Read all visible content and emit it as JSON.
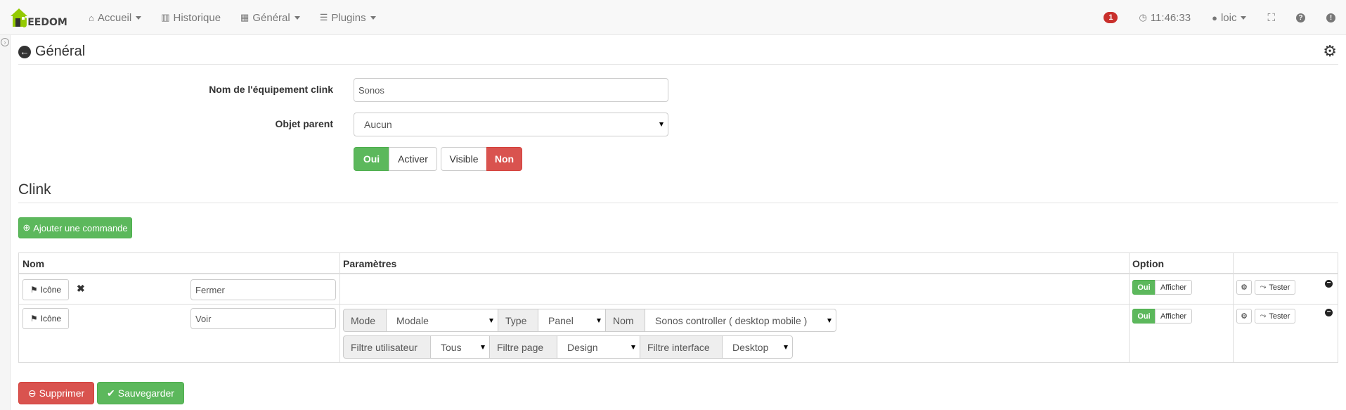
{
  "navbar": {
    "brand_first": "J",
    "brand_rest": "EEDOM",
    "items": [
      {
        "label": "Accueil",
        "icon": "home-icon"
      },
      {
        "label": "Historique",
        "icon": "bar-chart-icon"
      },
      {
        "label": "Général",
        "icon": "qrcode-icon"
      },
      {
        "label": "Plugins",
        "icon": "tasks-icon"
      }
    ],
    "notification_count": "1",
    "clock": "11:46:33",
    "user": "loic"
  },
  "page": {
    "title": "Général",
    "equipment_name_label": "Nom de l'équipement clink",
    "equipment_name_value": "Sonos",
    "parent_label": "Objet parent",
    "parent_value": "Aucun",
    "toggle_active_on": "Oui",
    "toggle_active_label": "Activer",
    "toggle_visible_label": "Visible",
    "toggle_visible_off": "Non"
  },
  "section": {
    "title": "Clink",
    "add_command": "Ajouter une commande"
  },
  "table": {
    "headers": [
      "Nom",
      "Paramètres",
      "Option",
      ""
    ],
    "rows": [
      {
        "icon_btn": "Icône",
        "name": "Fermer",
        "option_on": "Oui",
        "option_label": "Afficher",
        "test_label": "Tester"
      },
      {
        "icon_btn": "Icône",
        "name": "Voir",
        "mode_label": "Mode",
        "mode_value": "Modale",
        "type_label": "Type",
        "type_value": "Panel",
        "nom_label": "Nom",
        "nom_value": "Sonos controller ( desktop mobile )",
        "user_filter_label": "Filtre utilisateur",
        "user_filter_value": "Tous",
        "page_filter_label": "Filtre page",
        "page_filter_value": "Design",
        "interface_filter_label": "Filtre interface",
        "interface_filter_value": "Desktop",
        "option_on": "Oui",
        "option_label": "Afficher",
        "test_label": "Tester"
      }
    ]
  },
  "actions": {
    "delete": "Supprimer",
    "save": "Sauvegarder"
  },
  "colors": {
    "success": "#5cb85c",
    "danger": "#d9534f",
    "brand_green": "#94ca02"
  }
}
